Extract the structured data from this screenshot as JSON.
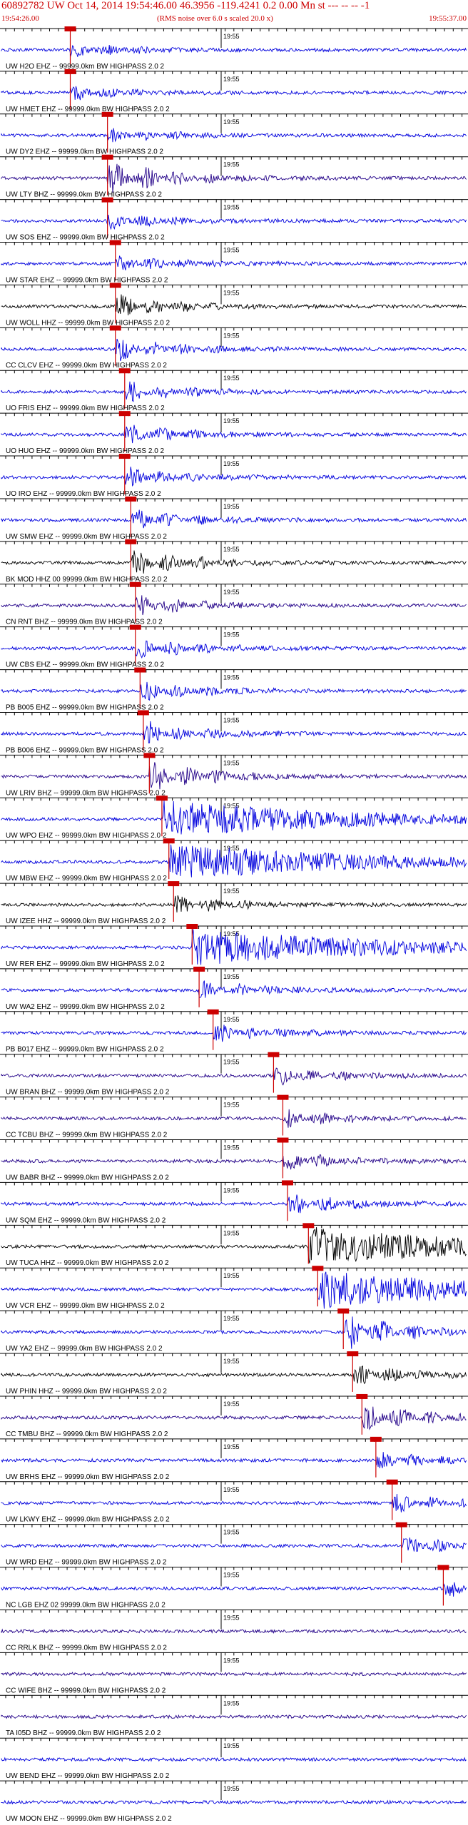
{
  "header": {
    "title": "60892782 UW Oct 14, 2014 19:54:46.00   46.3956 -119.4241  0.2 0.00 Mn st --- -- --  -1",
    "start_time": "19:54:26.00",
    "note": "(RMS noise over 6.0 s scaled 20.0 x)",
    "end_time": "19:55:37.00"
  },
  "colors": {
    "pick": "#cc0000",
    "axis": "#000000"
  },
  "minute_label": "19:55",
  "traces": [
    {
      "label": "UW H2O EHZ -- 99999.0km BW  HIGHPASS  2.0  2",
      "color": "#0000dd",
      "pick": 0.148,
      "amp": 0.35
    },
    {
      "label": "UW HMET EHZ -- 99999.0km BW  HIGHPASS  2.0  2",
      "color": "#0000dd",
      "pick": 0.148,
      "amp": 0.35
    },
    {
      "label": "UW DY2 EHZ -- 99999.0km BW  HIGHPASS  2.0  2",
      "color": "#0000dd",
      "pick": 0.228,
      "amp": 0.35
    },
    {
      "label": "UW LTY BHZ -- 99999.0km BW  HIGHPASS  2.0  2",
      "color": "#220088",
      "pick": 0.228,
      "amp": 0.85
    },
    {
      "label": "UW SOS EHZ -- 99999.0km BW  HIGHPASS  2.0  2",
      "color": "#0000dd",
      "pick": 0.228,
      "amp": 0.4
    },
    {
      "label": "UW STAR EHZ -- 99999.0km BW  HIGHPASS  2.0  2",
      "color": "#0000dd",
      "pick": 0.245,
      "amp": 0.4
    },
    {
      "label": "UW WOLL HHZ -- 99999.0km BW  HIGHPASS  2.0  2",
      "color": "#000000",
      "pick": 0.245,
      "amp": 0.6
    },
    {
      "label": "CC CLCV EHZ -- 99999.0km BW  HIGHPASS  2.0  2",
      "color": "#0000dd",
      "pick": 0.245,
      "amp": 0.6
    },
    {
      "label": "UO FRIS EHZ -- 99999.0km BW  HIGHPASS  2.0  2",
      "color": "#0000dd",
      "pick": 0.265,
      "amp": 0.5
    },
    {
      "label": "UO HUO EHZ -- 99999.0km BW  HIGHPASS  2.0  2",
      "color": "#0000dd",
      "pick": 0.265,
      "amp": 0.5
    },
    {
      "label": "UO IRO EHZ -- 99999.0km BW  HIGHPASS  2.0  2",
      "color": "#0000dd",
      "pick": 0.265,
      "amp": 0.5
    },
    {
      "label": "UW SMW EHZ -- 99999.0km BW  HIGHPASS  2.0  2",
      "color": "#0000dd",
      "pick": 0.278,
      "amp": 0.5
    },
    {
      "label": "BK MOD HHZ 00 99999.0km BW  HIGHPASS  2.0  2",
      "color": "#000000",
      "pick": 0.278,
      "amp": 0.7
    },
    {
      "label": "CN RNT BHZ -- 99999.0km BW  HIGHPASS  2.0  2",
      "color": "#220088",
      "pick": 0.288,
      "amp": 0.5
    },
    {
      "label": "UW CBS EHZ -- 99999.0km BW  HIGHPASS  2.0  2",
      "color": "#0000dd",
      "pick": 0.288,
      "amp": 0.5
    },
    {
      "label": "PB B005 EHZ -- 99999.0km BW  HIGHPASS  2.0  2",
      "color": "#0000dd",
      "pick": 0.298,
      "amp": 0.5
    },
    {
      "label": "PB B006 EHZ -- 99999.0km BW  HIGHPASS  2.0  2",
      "color": "#0000dd",
      "pick": 0.305,
      "amp": 0.6
    },
    {
      "label": "UW LRIV BHZ -- 99999.0km BW  HIGHPASS  2.0  2",
      "color": "#220088",
      "pick": 0.318,
      "amp": 0.8
    },
    {
      "label": "UW WPO EHZ -- 99999.0km BW  HIGHPASS  2.0  2",
      "color": "#0000dd",
      "pick": 0.345,
      "amp": 0.95
    },
    {
      "label": "UW MBW EHZ -- 99999.0km BW  HIGHPASS  2.0  2",
      "color": "#0000dd",
      "pick": 0.36,
      "amp": 0.95
    },
    {
      "label": "UW IZEE HHZ -- 99999.0km BW  HIGHPASS  2.0  2",
      "color": "#000000",
      "pick": 0.37,
      "amp": 0.5
    },
    {
      "label": "UW RER EHZ -- 99999.0km BW  HIGHPASS  2.0  2",
      "color": "#0000dd",
      "pick": 0.41,
      "amp": 0.95
    },
    {
      "label": "UW WA2 EHZ -- 99999.0km BW  HIGHPASS  2.0  2",
      "color": "#0000dd",
      "pick": 0.425,
      "amp": 0.5
    },
    {
      "label": "PB B017 EHZ -- 99999.0km BW  HIGHPASS  2.0  2",
      "color": "#0000dd",
      "pick": 0.455,
      "amp": 0.45
    },
    {
      "label": "UW BRAN BHZ -- 99999.0km BW  HIGHPASS  2.0  2",
      "color": "#220088",
      "pick": 0.585,
      "amp": 0.45
    },
    {
      "label": "CC TCBU BHZ -- 99999.0km BW  HIGHPASS  2.0  2",
      "color": "#220088",
      "pick": 0.605,
      "amp": 0.45
    },
    {
      "label": "UW BABR BHZ -- 99999.0km BW  HIGHPASS  2.0  2",
      "color": "#220088",
      "pick": 0.605,
      "amp": 0.45
    },
    {
      "label": "UW SQM EHZ -- 99999.0km BW  HIGHPASS  2.0  2",
      "color": "#0000dd",
      "pick": 0.615,
      "amp": 0.55
    },
    {
      "label": "UW TUCA HHZ -- 99999.0km BW  HIGHPASS  2.0  2",
      "color": "#000000",
      "pick": 0.66,
      "amp": 1.0
    },
    {
      "label": "UW VCR EHZ -- 99999.0km BW  HIGHPASS  2.0  2",
      "color": "#0000dd",
      "pick": 0.68,
      "amp": 1.0
    },
    {
      "label": "UW YA2 EHZ -- 99999.0km BW  HIGHPASS  2.0  2",
      "color": "#0000dd",
      "pick": 0.735,
      "amp": 0.9
    },
    {
      "label": "UW PHIN HHZ -- 99999.0km BW  HIGHPASS  2.0  2",
      "color": "#000000",
      "pick": 0.755,
      "amp": 0.5
    },
    {
      "label": "CC TMBU BHZ -- 99999.0km BW  HIGHPASS  2.0  2",
      "color": "#220088",
      "pick": 0.775,
      "amp": 0.7
    },
    {
      "label": "UW BRHS EHZ -- 99999.0km BW  HIGHPASS  2.0  2",
      "color": "#0000dd",
      "pick": 0.805,
      "amp": 0.45
    },
    {
      "label": "UW LKWY EHZ -- 99999.0km BW  HIGHPASS  2.0  2",
      "color": "#0000dd",
      "pick": 0.84,
      "amp": 0.45
    },
    {
      "label": "UW WRD EHZ -- 99999.0km BW  HIGHPASS  2.0  2",
      "color": "#0000dd",
      "pick": 0.86,
      "amp": 0.45
    },
    {
      "label": "NC LGB EHZ 02 99999.0km BW  HIGHPASS  2.0  2",
      "color": "#0000dd",
      "pick": 0.95,
      "amp": 0.4
    },
    {
      "label": "CC RRLK BHZ -- 99999.0km BW  HIGHPASS  2.0  2",
      "color": "#220088",
      "pick": null,
      "amp": 0.3
    },
    {
      "label": "CC WIFE BHZ -- 99999.0km BW  HIGHPASS  2.0  2",
      "color": "#220088",
      "pick": null,
      "amp": 0.3
    },
    {
      "label": "TA I05D BHZ -- 99999.0km BW  HIGHPASS  2.0  2",
      "color": "#220088",
      "pick": null,
      "amp": 0.3
    },
    {
      "label": "UW BEND EHZ -- 99999.0km BW  HIGHPASS  2.0  2",
      "color": "#0000dd",
      "pick": null,
      "amp": 0.3
    },
    {
      "label": "UW MOON EHZ -- 99999.0km BW  HIGHPASS  2.0  2",
      "color": "#0000dd",
      "pick": null,
      "amp": 0.3
    }
  ]
}
